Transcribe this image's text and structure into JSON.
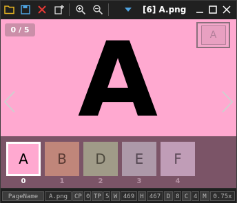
{
  "window": {
    "title": "[6] A.png"
  },
  "toolbar": {
    "icons": [
      "folder-open-icon",
      "save-icon",
      "close-x-icon",
      "new-window-icon",
      "zoom-in-icon",
      "zoom-out-icon",
      "dropdown-arrow-icon"
    ],
    "colors": {
      "folder": "#e6b422",
      "save": "#4fa3e0",
      "close": "#e53935"
    }
  },
  "viewer": {
    "counter": "0 / 5",
    "letter": "A",
    "mini_letter": "A",
    "background": "#ffa9d0"
  },
  "thumbnails": [
    {
      "letter": "A",
      "index": "0",
      "bg": "#ffa9d0",
      "color": "#000000",
      "selected": true
    },
    {
      "letter": "B",
      "index": "1",
      "bg": "#c0867a",
      "color": "#5a3a33",
      "selected": false
    },
    {
      "letter": "D",
      "index": "2",
      "bg": "#a09b88",
      "color": "#4e4a3e",
      "selected": false
    },
    {
      "letter": "E",
      "index": "3",
      "bg": "#ad99a9",
      "color": "#544752",
      "selected": false
    },
    {
      "letter": "F",
      "index": "4",
      "bg": "#c09db7",
      "color": "#5d4a58",
      "selected": false
    }
  ],
  "status": {
    "page_label": "PageName",
    "page_value": "A.png",
    "cp_label": "CP",
    "cp_value": "0",
    "tp_label": "TP",
    "tp_value": "5",
    "w_label": "W",
    "w_value": "469",
    "h_label": "H",
    "h_value": "467",
    "d_label": "D",
    "d_value": "8",
    "c_label": "C",
    "c_value": "4",
    "m_label": "M",
    "m_value": "0.75x"
  }
}
